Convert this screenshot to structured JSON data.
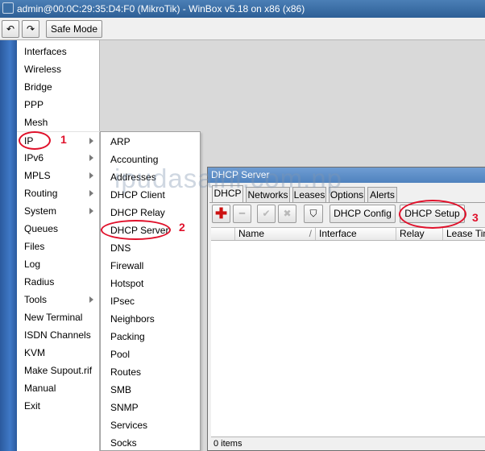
{
  "window": {
    "title": "admin@00:0C:29:35:D4:F0 (MikroTik) - WinBox v5.18 on x86 (x86)"
  },
  "toolbar": {
    "undo_icon": "↶",
    "redo_icon": "↷",
    "safe_mode_label": "Safe Mode"
  },
  "main_menu": [
    {
      "label": "Interfaces",
      "has_submenu": false
    },
    {
      "label": "Wireless",
      "has_submenu": false
    },
    {
      "label": "Bridge",
      "has_submenu": false
    },
    {
      "label": "PPP",
      "has_submenu": false
    },
    {
      "label": "Mesh",
      "has_submenu": false
    },
    {
      "label": "IP",
      "has_submenu": true
    },
    {
      "label": "IPv6",
      "has_submenu": true
    },
    {
      "label": "MPLS",
      "has_submenu": true
    },
    {
      "label": "Routing",
      "has_submenu": true
    },
    {
      "label": "System",
      "has_submenu": true
    },
    {
      "label": "Queues",
      "has_submenu": false
    },
    {
      "label": "Files",
      "has_submenu": false
    },
    {
      "label": "Log",
      "has_submenu": false
    },
    {
      "label": "Radius",
      "has_submenu": false
    },
    {
      "label": "Tools",
      "has_submenu": true
    },
    {
      "label": "New Terminal",
      "has_submenu": false
    },
    {
      "label": "ISDN Channels",
      "has_submenu": false
    },
    {
      "label": "KVM",
      "has_submenu": false
    },
    {
      "label": "Make Supout.rif",
      "has_submenu": false
    },
    {
      "label": "Manual",
      "has_submenu": false
    },
    {
      "label": "Exit",
      "has_submenu": false
    }
  ],
  "ip_submenu": [
    "ARP",
    "Accounting",
    "Addresses",
    "DHCP Client",
    "DHCP Relay",
    "DHCP Server",
    "DNS",
    "Firewall",
    "Hotspot",
    "IPsec",
    "Neighbors",
    "Packing",
    "Pool",
    "Routes",
    "SMB",
    "SNMP",
    "Services",
    "Socks"
  ],
  "dhcp_window": {
    "title": "DHCP Server",
    "tabs": [
      "DHCP",
      "Networks",
      "Leases",
      "Options",
      "Alerts"
    ],
    "active_tab": "DHCP",
    "buttons": {
      "add_icon": "✚",
      "remove_icon": "━",
      "enable_icon": "✔",
      "disable_icon": "✖",
      "filter_icon": "⛉",
      "config_label": "DHCP Config",
      "setup_label": "DHCP Setup"
    },
    "columns": [
      "",
      "Name",
      "Interface",
      "Relay",
      "Lease Tim"
    ],
    "rows": [],
    "status": "0 items"
  },
  "annotations": {
    "step1": "1",
    "step2": "2",
    "step3": "3"
  },
  "watermark": "ipudasaini.com.np",
  "colors": {
    "accent_red": "#e0102a",
    "title_blue": "#2d5f96",
    "strip_blue": "#3f79c7"
  }
}
